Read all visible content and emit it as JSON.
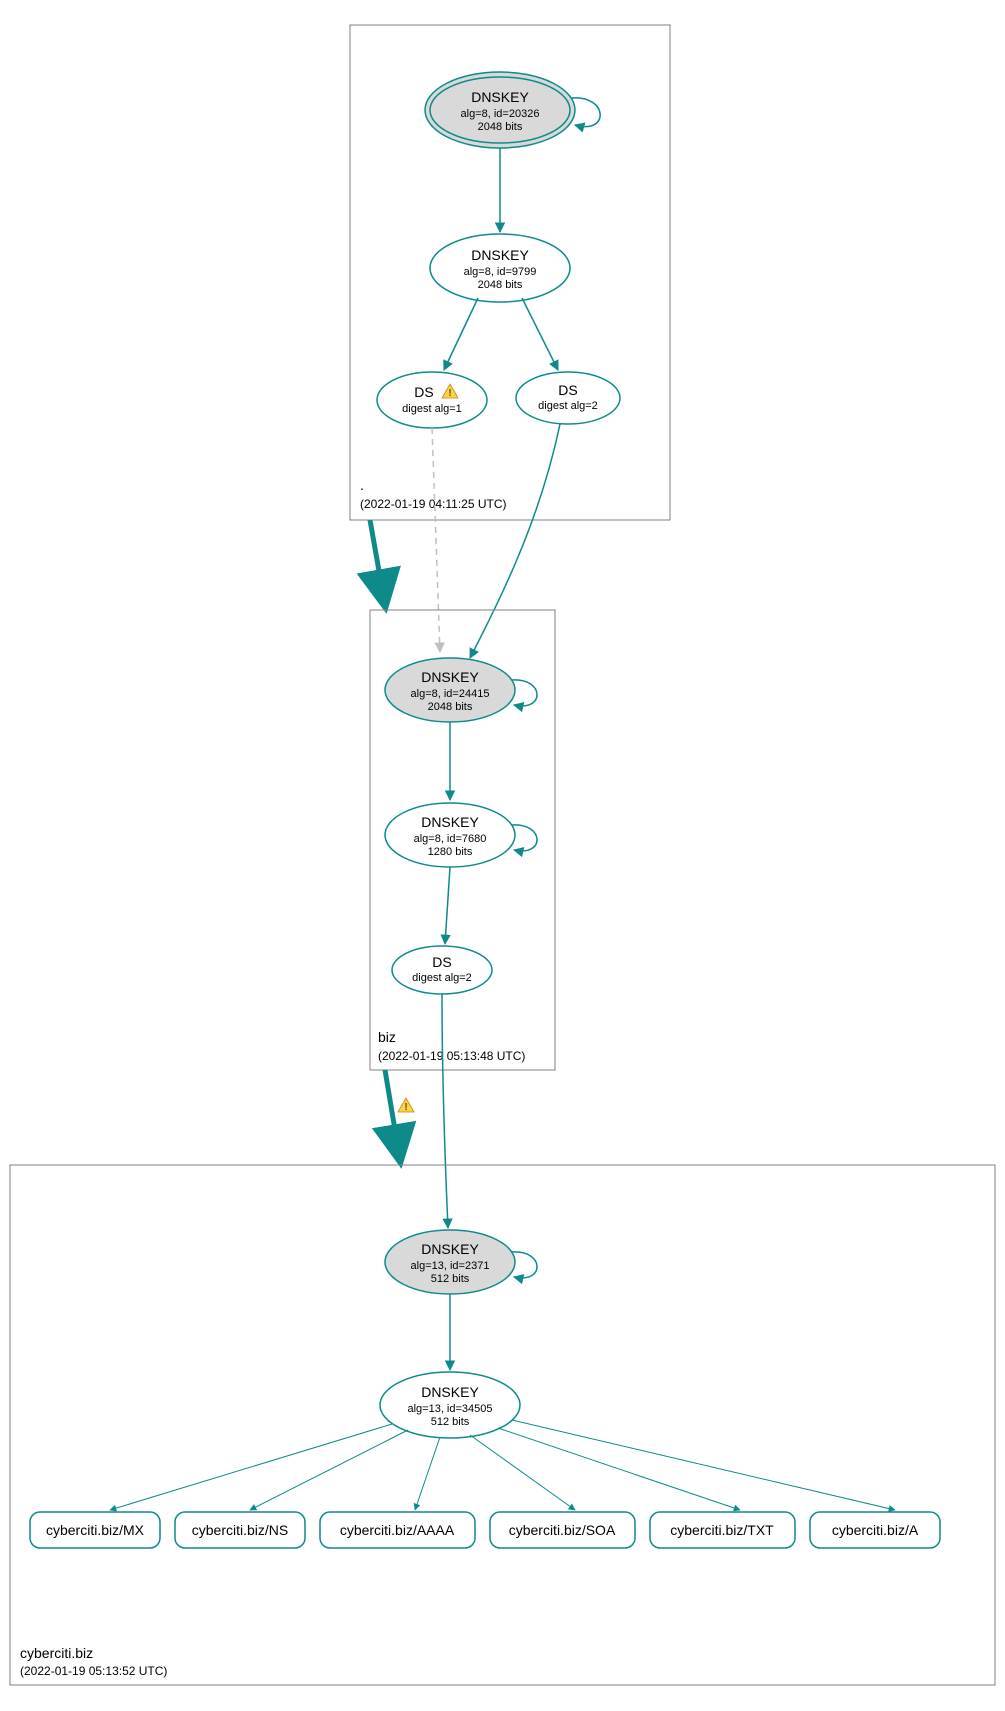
{
  "zones": {
    "root": {
      "label": ".",
      "timestamp": "(2022-01-19 04:11:25 UTC)"
    },
    "biz": {
      "label": "biz",
      "timestamp": "(2022-01-19 05:13:48 UTC)"
    },
    "cyberciti": {
      "label": "cyberciti.biz",
      "timestamp": "(2022-01-19 05:13:52 UTC)"
    }
  },
  "nodes": {
    "root_ksk": {
      "title": "DNSKEY",
      "line1": "alg=8, id=20326",
      "line2": "2048 bits"
    },
    "root_zsk": {
      "title": "DNSKEY",
      "line1": "alg=8, id=9799",
      "line2": "2048 bits"
    },
    "root_ds1": {
      "title": "DS",
      "line1": "digest alg=1"
    },
    "root_ds2": {
      "title": "DS",
      "line1": "digest alg=2"
    },
    "biz_ksk": {
      "title": "DNSKEY",
      "line1": "alg=8, id=24415",
      "line2": "2048 bits"
    },
    "biz_zsk": {
      "title": "DNSKEY",
      "line1": "alg=8, id=7680",
      "line2": "1280 bits"
    },
    "biz_ds": {
      "title": "DS",
      "line1": "digest alg=2"
    },
    "cb_ksk": {
      "title": "DNSKEY",
      "line1": "alg=13, id=2371",
      "line2": "512 bits"
    },
    "cb_zsk": {
      "title": "DNSKEY",
      "line1": "alg=13, id=34505",
      "line2": "512 bits"
    }
  },
  "records": {
    "mx": "cyberciti.biz/MX",
    "ns": "cyberciti.biz/NS",
    "aaaa": "cyberciti.biz/AAAA",
    "soa": "cyberciti.biz/SOA",
    "txt": "cyberciti.biz/TXT",
    "a": "cyberciti.biz/A"
  },
  "colors": {
    "teal": "#0e8a8a",
    "grayFill": "#d9d9d9",
    "boxStroke": "#808080"
  }
}
